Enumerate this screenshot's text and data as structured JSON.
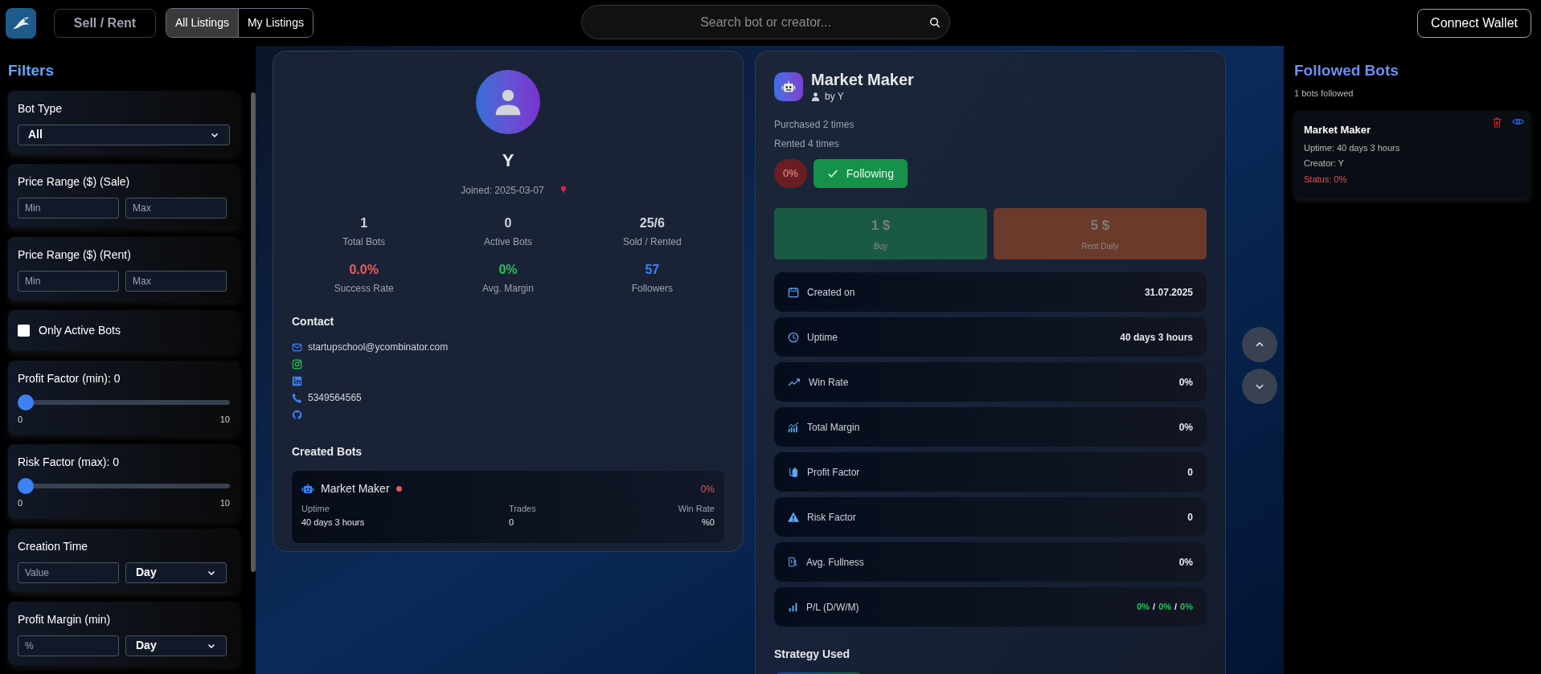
{
  "top_bar": {
    "sell_rent_button": "Sell / Rent",
    "tabs": [
      {
        "label": "All Listings",
        "selected": true
      },
      {
        "label": "My Listings",
        "selected": false
      }
    ],
    "search": {
      "placeholder": "Search bot or creator..."
    },
    "connect_button": "Connect Wallet"
  },
  "filters": {
    "title": "Filters",
    "groups": [
      {
        "kind": "select",
        "label": "Bot Type",
        "value": "All"
      },
      {
        "kind": "range",
        "label": "Price Range ($) (Sale)",
        "placeholders": [
          "Min",
          "Max"
        ]
      },
      {
        "kind": "range",
        "label": "Price Range ($) (Rent)",
        "placeholders": [
          "Min",
          "Max"
        ]
      },
      {
        "kind": "checkbox",
        "label": "Only Active Bots",
        "checked": false
      },
      {
        "kind": "slider",
        "label": "Profit Factor (min): 0",
        "level": 0,
        "min_label": "0",
        "max_label": "10"
      },
      {
        "kind": "slider",
        "label": "Risk Factor (max): 0",
        "level": 0,
        "min_label": "0",
        "max_label": "10"
      },
      {
        "kind": "input_select",
        "label": "Creation Time",
        "placeholder": "Value",
        "value": "Day"
      },
      {
        "kind": "input_select",
        "label": "Profit Margin (min)",
        "placeholder": "%",
        "value": "Day"
      }
    ]
  },
  "profile": {
    "name": "Y",
    "joined": "Joined: 2025-03-07",
    "stats": [
      {
        "value": "1",
        "label": "Total Bots",
        "color": "#d1d5db"
      },
      {
        "value": "0",
        "label": "Active Bots",
        "color": "#d1d5db"
      },
      {
        "value": "25/6",
        "label": "Sold / Rented",
        "color": "#d1d5db"
      },
      {
        "value": "0.0%",
        "label": "Success Rate",
        "color": "#ef5b5b"
      },
      {
        "value": "0%",
        "label": "Avg. Margin",
        "color": "#22c55e"
      },
      {
        "value": "57",
        "label": "Followers",
        "color": "#3b82f6"
      }
    ],
    "contact_title": "Contact",
    "contacts": [
      {
        "kind": "email",
        "text": "startupschool@ycombinator.com"
      },
      {
        "kind": "instagram"
      },
      {
        "kind": "linkedin"
      },
      {
        "kind": "phone",
        "text": "5349564565"
      },
      {
        "kind": "github"
      }
    ],
    "created_title": "Created Bots",
    "created_bots": [
      {
        "name": "Market Maker",
        "active": false,
        "rate": "0%",
        "columns": [
          {
            "label": "Uptime",
            "value": "40 days 3 hours"
          },
          {
            "label": "Trades",
            "value": "0"
          },
          {
            "label": "Win Rate",
            "value": "%0"
          }
        ]
      }
    ]
  },
  "bot": {
    "name": "Market Maker",
    "creator": "by Y",
    "purchased": "Purchased 2 times",
    "rented": "Rented 4 times",
    "rate_badge": "0%",
    "following": true,
    "following_label": "Following",
    "prices": [
      {
        "kind": "buy",
        "amount": "1 $",
        "label": "Buy"
      },
      {
        "kind": "rent",
        "amount": "5 $",
        "label": "Rent Daily"
      }
    ],
    "stats": [
      {
        "label": "Created on",
        "value": "31.07.2025"
      },
      {
        "label": "Uptime",
        "value": "40 days 3 hours"
      },
      {
        "label": "Win Rate",
        "value": "0%"
      },
      {
        "label": "Total Margin",
        "value": "0%"
      },
      {
        "label": "Profit Factor",
        "value": "0"
      },
      {
        "label": "Risk Factor",
        "value": "0"
      },
      {
        "label": "Avg. Fullness",
        "value": "0%"
      },
      {
        "label": "P/L (D/W/M)",
        "parts": [
          {
            "kind": "value",
            "text": "0%"
          },
          {
            "kind": "sep",
            "text": "/"
          },
          {
            "kind": "value",
            "text": "0%"
          },
          {
            "kind": "sep",
            "text": "/"
          },
          {
            "kind": "value",
            "text": "0%"
          }
        ]
      }
    ],
    "strategy_title": "Strategy Used"
  },
  "followed": {
    "title": "Followed Bots",
    "count": "1 bots followed",
    "bots": [
      {
        "name": "Market Maker",
        "uptime": "Uptime: 40 days 3 hours",
        "creator": "Creator: Y",
        "status": "Status: 0%"
      }
    ]
  }
}
